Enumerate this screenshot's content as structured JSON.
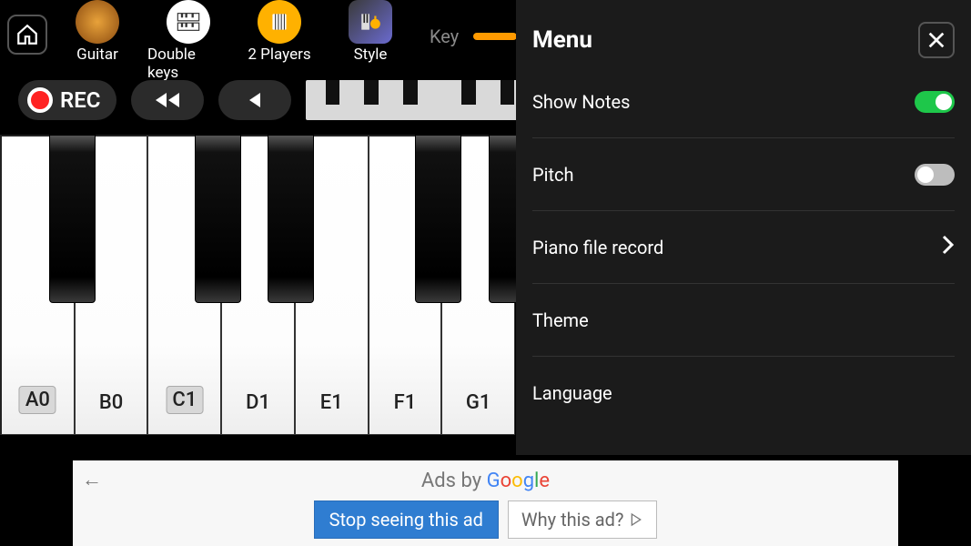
{
  "toolbar": {
    "items": [
      {
        "label": "Guitar"
      },
      {
        "label": "Double keys"
      },
      {
        "label": "2 Players"
      },
      {
        "label": "Style"
      }
    ],
    "key_label": "Key"
  },
  "controls": {
    "rec_label": "REC"
  },
  "piano": {
    "white_notes": [
      "A0",
      "B0",
      "C1",
      "D1",
      "E1",
      "F1",
      "G1"
    ],
    "boxed_notes": [
      "A0",
      "C1"
    ]
  },
  "menu": {
    "title": "Menu",
    "items": [
      {
        "label": "Show Notes",
        "type": "toggle",
        "on": true
      },
      {
        "label": "Pitch",
        "type": "toggle",
        "on": false
      },
      {
        "label": "Piano file record",
        "type": "nav"
      },
      {
        "label": "Theme",
        "type": "plain"
      },
      {
        "label": "Language",
        "type": "plain"
      }
    ]
  },
  "ad": {
    "banner_text": "Ads by Google",
    "stop_label": "Stop seeing this ad",
    "why_label": "Why this ad?"
  }
}
